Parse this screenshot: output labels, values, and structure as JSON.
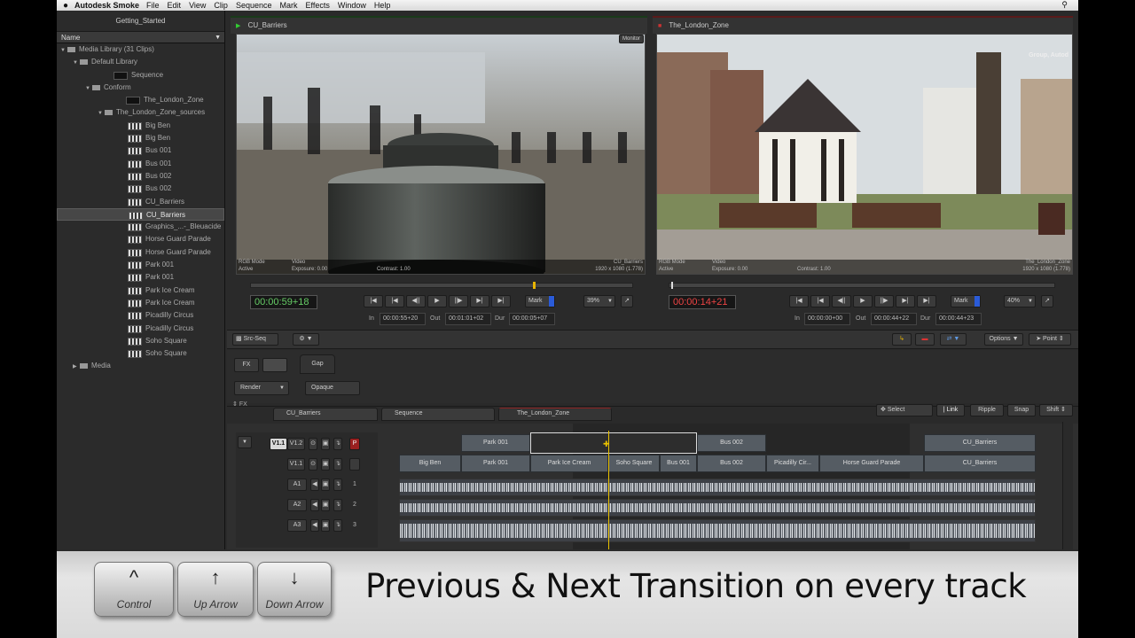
{
  "menubar": {
    "app_name": "Autodesk Smoke",
    "items": [
      "File",
      "Edit",
      "View",
      "Clip",
      "Sequence",
      "Mark",
      "Effects",
      "Window",
      "Help"
    ]
  },
  "library": {
    "title": "Getting_Started",
    "column_header": "Name",
    "items": [
      {
        "label": "Media Library (31 Clips)",
        "indent": 0,
        "twisty": "▼",
        "type": "folder"
      },
      {
        "label": "Default Library",
        "indent": 1,
        "twisty": "▼",
        "type": "folder"
      },
      {
        "label": "Sequence",
        "indent": 2,
        "type": "clip"
      },
      {
        "label": "Conform",
        "indent": 2,
        "twisty": "▼",
        "type": "folder"
      },
      {
        "label": "The_London_Zone",
        "indent": 3,
        "type": "clip"
      },
      {
        "label": "The_London_Zone_sources",
        "indent": 3,
        "twisty": "▼",
        "type": "folder"
      },
      {
        "label": "Big Ben",
        "type": "clip"
      },
      {
        "label": "Big Ben",
        "type": "clip"
      },
      {
        "label": "Bus 001",
        "type": "clip"
      },
      {
        "label": "Bus 001",
        "type": "clip"
      },
      {
        "label": "Bus 002",
        "type": "clip"
      },
      {
        "label": "Bus 002",
        "type": "clip"
      },
      {
        "label": "CU_Barriers",
        "type": "clip"
      },
      {
        "label": "CU_Barriers",
        "type": "clip",
        "selected": true
      },
      {
        "label": "Graphics_...-_Bleuacide",
        "type": "clip"
      },
      {
        "label": "Horse Guard Parade",
        "type": "clip"
      },
      {
        "label": "Horse Guard Parade",
        "type": "clip"
      },
      {
        "label": "Park 001",
        "type": "clip"
      },
      {
        "label": "Park 001",
        "type": "clip"
      },
      {
        "label": "Park Ice Cream",
        "type": "clip"
      },
      {
        "label": "Park Ice Cream",
        "type": "clip"
      },
      {
        "label": "Picadilly Circus",
        "type": "clip"
      },
      {
        "label": "Picadilly Circus",
        "type": "clip"
      },
      {
        "label": "Soho Square",
        "type": "clip"
      },
      {
        "label": "Soho Square",
        "type": "clip"
      },
      {
        "label": "Media",
        "indent": 1,
        "twisty": "▶",
        "type": "folder"
      }
    ]
  },
  "source_viewer": {
    "tab": "CU_Barriers",
    "monitor_badge": "Monitor",
    "mode": "RGB Mode",
    "mode2": "Video",
    "active": "Active",
    "exposure": "Exposure: 0.00",
    "contrast": "Contrast: 1.00",
    "clip_name": "CU_Barriers",
    "resolution": "1920 x 1080 (1.778)",
    "timecode": "00:00:59+18",
    "in_label": "In",
    "in_value": "00:00:55+20",
    "out_label": "Out",
    "out_value": "00:01:01+02",
    "dur_label": "Dur",
    "dur_value": "00:00:05+07",
    "mark": "Mark",
    "zoom": "39%"
  },
  "record_viewer": {
    "tab": "The_London_Zone",
    "overlay": "Group, Autod",
    "mode": "RGB Mode",
    "mode2": "Video",
    "active": "Active",
    "exposure": "Exposure: 0.00",
    "contrast": "Contrast: 1.00",
    "clip_name": "The_London_Zone",
    "resolution": "1920 x 1080 (1.778)",
    "timecode": "00:00:14+21",
    "in_label": "In",
    "in_value": "00:00:00+00",
    "out_label": "Out",
    "out_value": "00:00:44+22",
    "dur_label": "Dur",
    "dur_value": "00:00:44+23",
    "mark": "Mark",
    "zoom": "40%"
  },
  "toolbar": {
    "src_seq": "Src-Seq",
    "options": "Options",
    "point": "Point"
  },
  "fx": {
    "fx_label": "FX",
    "gap_tab": "Gap",
    "render": "Render",
    "opaque": "Opaque",
    "fx_small": "FX"
  },
  "timeline_tabs": [
    "CU_Barriers",
    "Sequence",
    "The_London_Zone"
  ],
  "timeline_tools": {
    "select": "Select",
    "link": "Link",
    "ripple": "Ripple",
    "snap": "Snap",
    "shift": "Shift"
  },
  "tracks": {
    "v_top": [
      "V1.1",
      "V1.2"
    ],
    "v1": "V1.1",
    "p_badge": "P",
    "audio": [
      {
        "name": "A1",
        "num": "1"
      },
      {
        "name": "A2",
        "num": "2"
      },
      {
        "name": "A3",
        "num": "3"
      }
    ],
    "upper_segments": [
      "Park 001",
      "Bus 002",
      "CU_Barriers"
    ],
    "lower_segments": [
      "Big Ben",
      "Park 001",
      "Park Ice Cream",
      "Soho Square",
      "Bus 001",
      "Bus 002",
      "Picadilly Cir...",
      "Horse Guard Parade",
      "CU_Barriers"
    ]
  },
  "banner": {
    "keys": [
      {
        "symbol": "^",
        "label": "Control"
      },
      {
        "symbol": "↑",
        "label": "Up Arrow"
      },
      {
        "symbol": "↓",
        "label": "Down Arrow"
      }
    ],
    "caption": "Previous & Next Transition on every track"
  }
}
